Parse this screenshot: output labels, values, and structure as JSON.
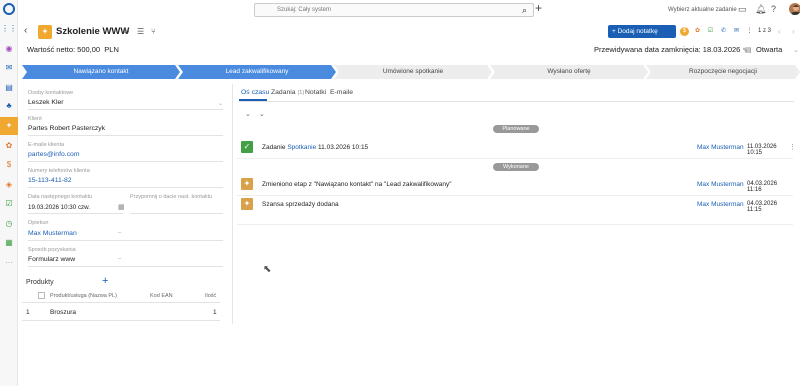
{
  "topbar": {
    "search_placeholder": "Szukaj: Cały system",
    "task_placeholder": "Wybierz aktualne zadanie"
  },
  "header": {
    "title": "Szkolenie WWW",
    "add_note_label": "Dodaj notatkę",
    "pager": "1 z 3"
  },
  "summary": {
    "net_value": "Wartość netto: 500,00",
    "currency": "PLN",
    "close_date": "Przewidywana data zamknięcia: 18.03.2026",
    "status": "Otwarta"
  },
  "pipeline": [
    {
      "label": "Nawiązano kontakt",
      "state": "done"
    },
    {
      "label": "Lead zakwalifikowany",
      "state": "done"
    },
    {
      "label": "Umówione spotkanie",
      "state": "todo"
    },
    {
      "label": "Wysłano ofertę",
      "state": "todo"
    },
    {
      "label": "Rozpoczęcie negocjacji",
      "state": "todo"
    }
  ],
  "fields": {
    "contacts_label": "Osoby kontaktowe",
    "contacts_value": "Leszek Kler",
    "client_label": "Klient",
    "client_value": "Partes Robert Pasterczyk",
    "email_label": "E-maile klienta",
    "email_value": "partes@info.com",
    "phone_label": "Numery telefonów klienta",
    "phone_value": "15-113-411-82",
    "next_contact_label": "Data następnego kontaktu",
    "next_contact_value": "19.03.2026 10:30 czw.",
    "reminder_label": "Przypomnij o dacie nast. kontaktu",
    "owner_label": "Opiekun",
    "owner_value": "Max Musterman",
    "source_label": "Sposób pozyskania",
    "source_value": "Formularz www"
  },
  "products": {
    "title": "Produkty",
    "col_name": "Produkt/usługa (Nazwa PL)",
    "col_ean": "Kod EAN",
    "col_qty": "Ilość",
    "rows": [
      {
        "num": "1",
        "name": "Broszura",
        "ean": "",
        "qty": "1"
      }
    ]
  },
  "tabs": {
    "timeline": "Oś czasu",
    "tasks": "Zadania",
    "tasks_count": "(1)",
    "notes": "Notatki",
    "emails": "E-maile"
  },
  "timeline": {
    "planned_label": "Planowane",
    "done_label": "Wykonane",
    "events": [
      {
        "text_prefix": "Zadanie",
        "text_link": "Spotkanie",
        "text_suffix": "11.03.2026 10:15",
        "user": "Max Musterman",
        "date": "11.03.2026 10:15"
      },
      {
        "text_prefix": "Zmieniono etap z \"Nawiązano kontakt\" na \"Lead zakwalifikowany\"",
        "text_link": "",
        "text_suffix": "",
        "user": "Max Musterman",
        "date": "04.03.2026 11:16"
      },
      {
        "text_prefix": "Szansa sprzedaży dodana",
        "text_link": "",
        "text_suffix": "",
        "user": "Max Musterman",
        "date": "04.03.2026 11:15"
      }
    ]
  },
  "colors": {
    "accent": "#1a5fb4",
    "stage_done": "#4a8be0",
    "deal_orange": "#f0a830",
    "task_green": "#43a047"
  }
}
